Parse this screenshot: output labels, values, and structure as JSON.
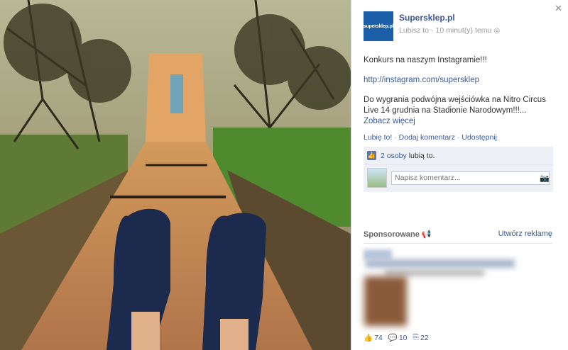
{
  "post": {
    "page_name": "Supersklep.pl",
    "logo_text": "supersklep.pl",
    "meta_like": "Lubisz to",
    "meta_sep": "·",
    "meta_time": "10 minut(y) temu",
    "paragraph1": "Konkurs na naszym Instagramie!!!",
    "link": "http://instagram.com/supersklep",
    "paragraph3": "Do wygrania podwójna wejściówka na Nitro Circus Live 14 grudnia na Stadionie Narodowym!!!...",
    "see_more": "Zobacz więcej"
  },
  "actions": {
    "like": "Lubię to!",
    "comment": "Dodaj komentarz",
    "share": "Udostępnij",
    "sep": "·"
  },
  "likes": {
    "count_link": "2 osoby",
    "suffix": "lubią to."
  },
  "comment": {
    "placeholder": "Napisz komentarz..."
  },
  "sponsored": {
    "title": "Sponsorowane",
    "create_ad": "Utwórz reklamę"
  },
  "ad_stats": {
    "likes": "74",
    "comments": "10",
    "shares": "22"
  },
  "icons": {
    "close": "close-icon",
    "globe": "globe-icon",
    "thumb": "thumbs-up-icon",
    "camera": "camera-icon",
    "megaphone": "megaphone-icon"
  },
  "colors": {
    "link": "#3b5998",
    "logo_bg": "#1a5fa8"
  }
}
